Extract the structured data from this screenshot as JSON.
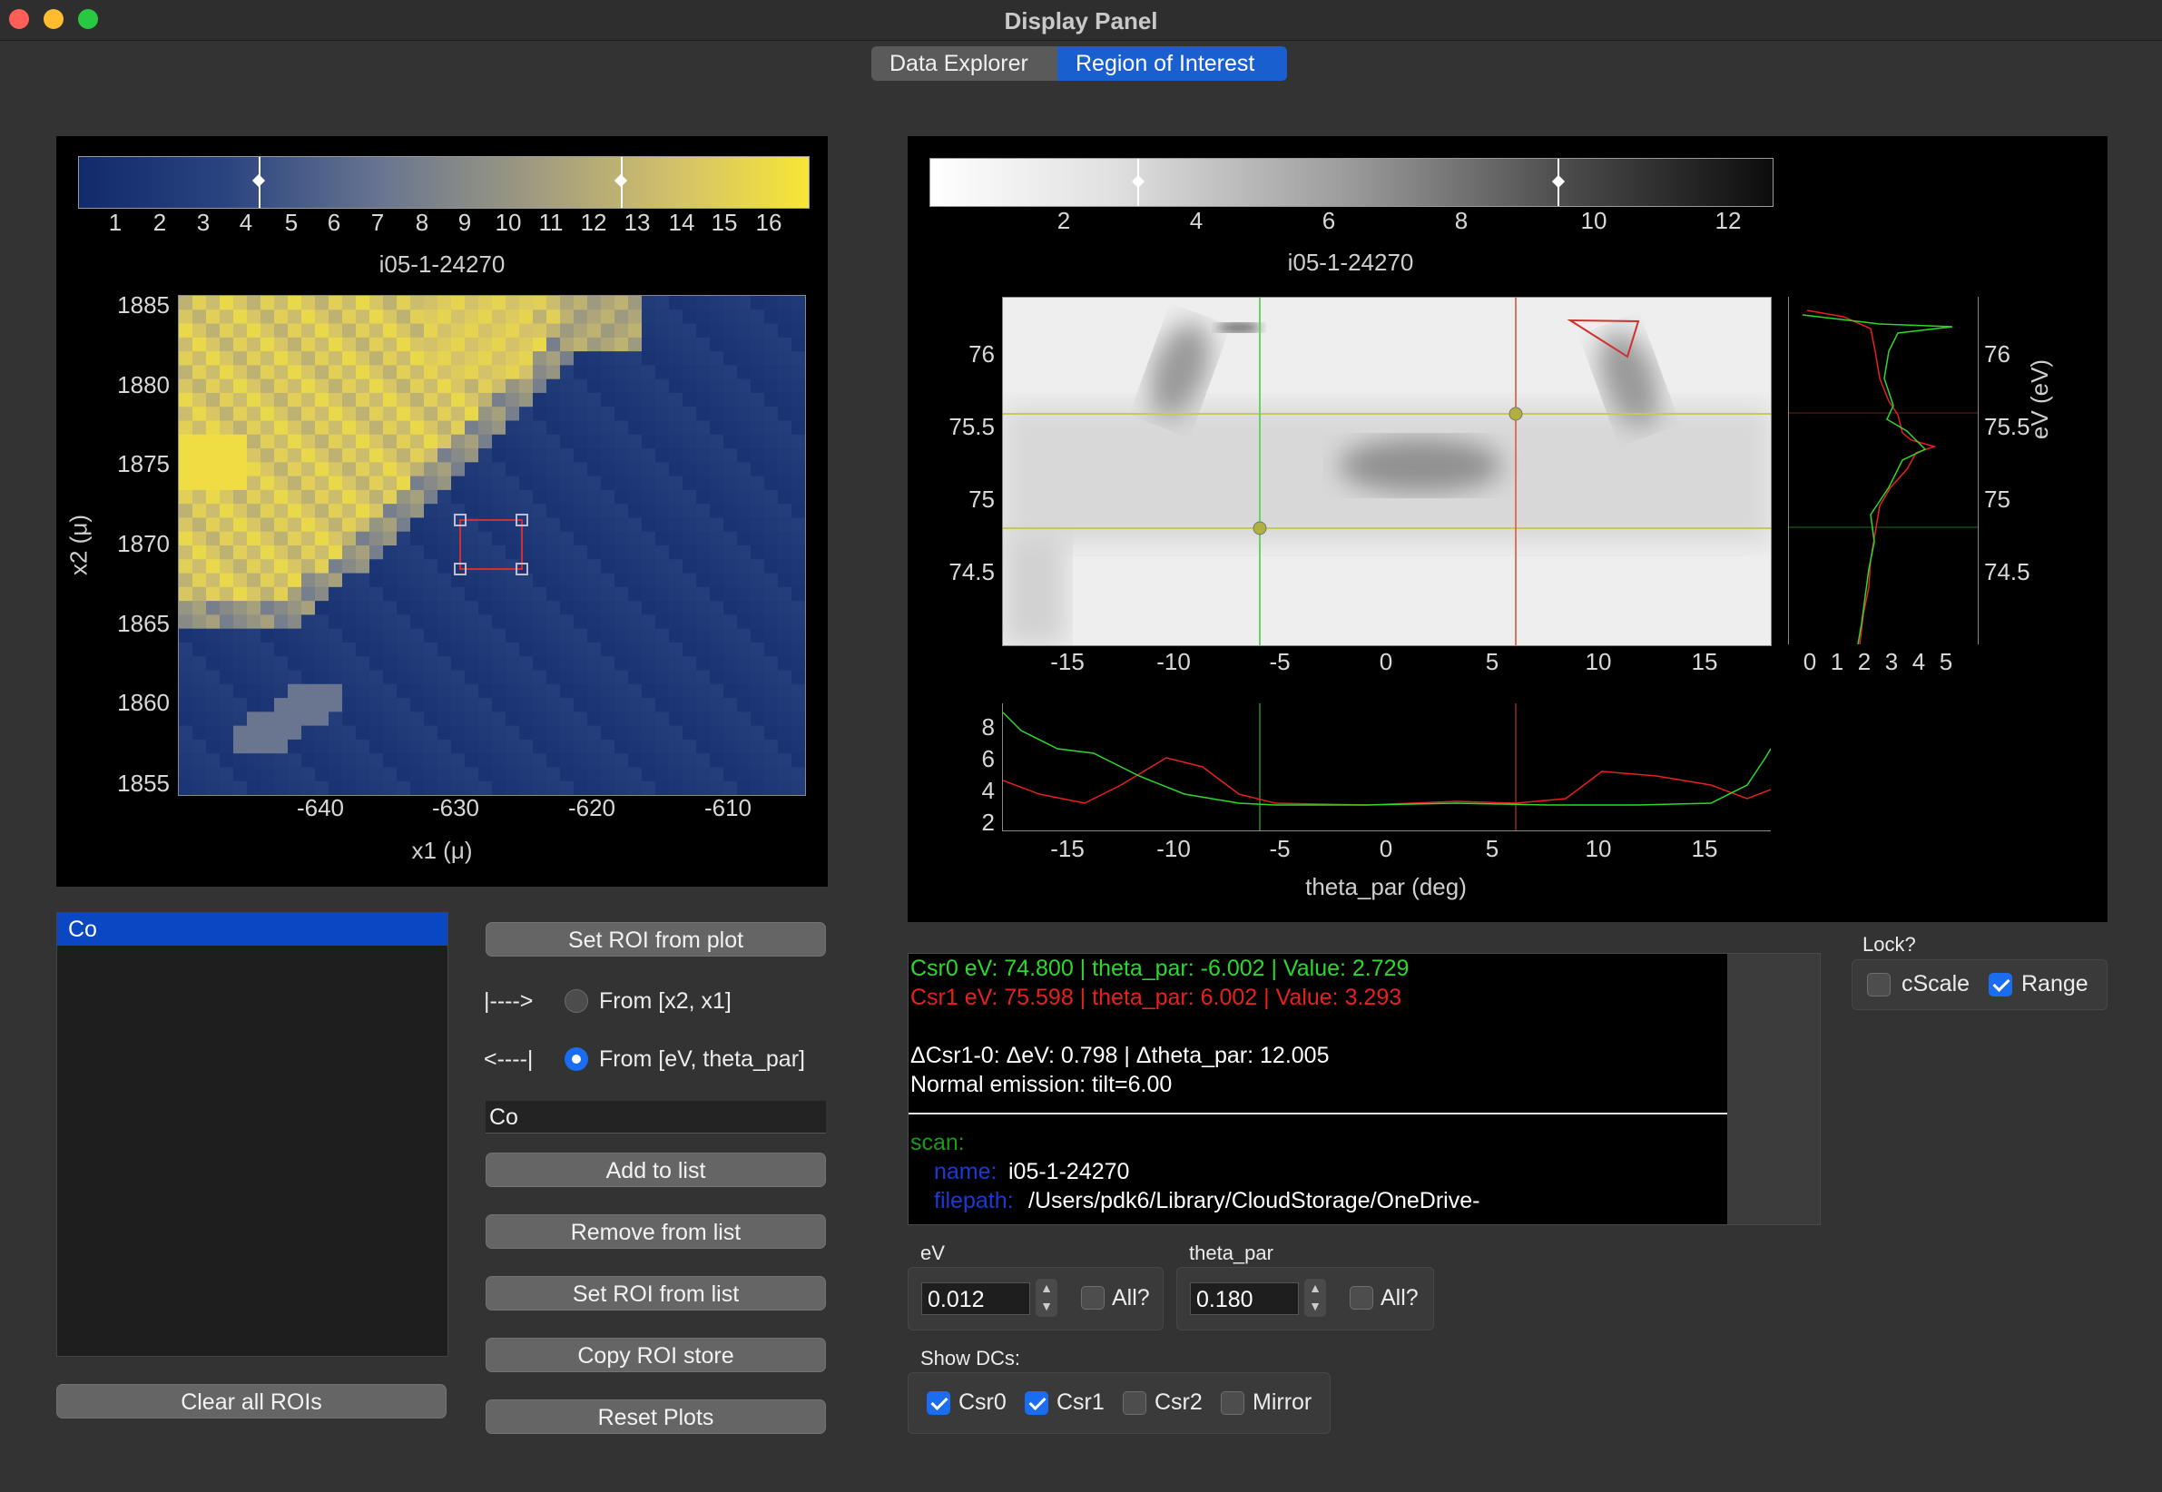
{
  "window": {
    "title": "Display Panel"
  },
  "tabs": [
    {
      "label": "Data Explorer"
    },
    {
      "label": "Region of Interest"
    }
  ],
  "colors": {
    "accent": "#1a5fd0",
    "csr0": "#2bd92b",
    "csr1": "#e82020",
    "roi": "#d03030"
  },
  "left_map": {
    "title": "i05-1-24270",
    "colorbar_ticks": [
      "1",
      "2",
      "3",
      "4",
      "5",
      "6",
      "7",
      "8",
      "9",
      "10",
      "11",
      "12",
      "13",
      "14",
      "15",
      "16"
    ],
    "y_ticks": [
      "1885",
      "1880",
      "1875",
      "1870",
      "1865",
      "1860",
      "1855"
    ],
    "x_ticks": [
      "-640",
      "-630",
      "-620",
      "-610"
    ],
    "xlabel": "x1 (μ)",
    "ylabel": "x2 (μ)"
  },
  "right_plot": {
    "title": "i05-1-24270",
    "colorbar_ticks": [
      "2",
      "4",
      "6",
      "8",
      "10",
      "12"
    ],
    "y_ticks": [
      "76",
      "75.5",
      "75",
      "74.5"
    ],
    "x_ticks": [
      "-15",
      "-10",
      "-5",
      "0",
      "5",
      "10",
      "15"
    ],
    "side_x_ticks": [
      "0",
      "1",
      "2",
      "3",
      "4",
      "5"
    ],
    "side_ylabel": "eV (eV)",
    "bottom_y_ticks": [
      "8",
      "6",
      "4",
      "2"
    ],
    "bottom_x_ticks": [
      "-15",
      "-10",
      "-5",
      "0",
      "5",
      "10",
      "15"
    ],
    "bottom_xlabel": "theta_par (deg)"
  },
  "roi_list": {
    "items": [
      "Co"
    ],
    "selected": "Co"
  },
  "controls": {
    "set_roi_from_plot": "Set ROI from plot",
    "arrow_right": "|---->",
    "arrow_left": "<----|",
    "from_x2x1": "From [x2, x1]",
    "from_ev_theta": "From [eV, theta_par]",
    "roi_name_value": "Co",
    "add_to_list": "Add to list",
    "remove_from_list": "Remove from list",
    "set_roi_from_list": "Set ROI from list",
    "copy_roi_store": "Copy ROI store",
    "reset_plots": "Reset Plots",
    "clear_all_rois": "Clear all ROIs"
  },
  "info": {
    "csr0": "Csr0 eV: 74.800 | theta_par: -6.002 | Value: 2.729",
    "csr1": "Csr1 eV: 75.598 | theta_par: 6.002 | Value: 3.293",
    "delta": "ΔCsr1-0: ΔeV: 0.798 | Δtheta_par: 12.005",
    "normal": "Normal emission: tilt=6.00",
    "scan_key": "scan:",
    "name_key": "name:",
    "name_val": "i05-1-24270",
    "filepath_key": "filepath:",
    "filepath_val": "/Users/pdk6/Library/CloudStorage/OneDrive-"
  },
  "lock": {
    "label": "Lock?",
    "cscale": "cScale",
    "range": "Range",
    "cscale_checked": false,
    "range_checked": true
  },
  "ev_box": {
    "label": "eV",
    "value": "0.012",
    "all": "All?"
  },
  "theta_box": {
    "label": "theta_par",
    "value": "0.180",
    "all": "All?"
  },
  "show_dcs": {
    "label": "Show DCs:",
    "csr0": "Csr0",
    "csr1": "Csr1",
    "csr2": "Csr2",
    "mirror": "Mirror"
  }
}
